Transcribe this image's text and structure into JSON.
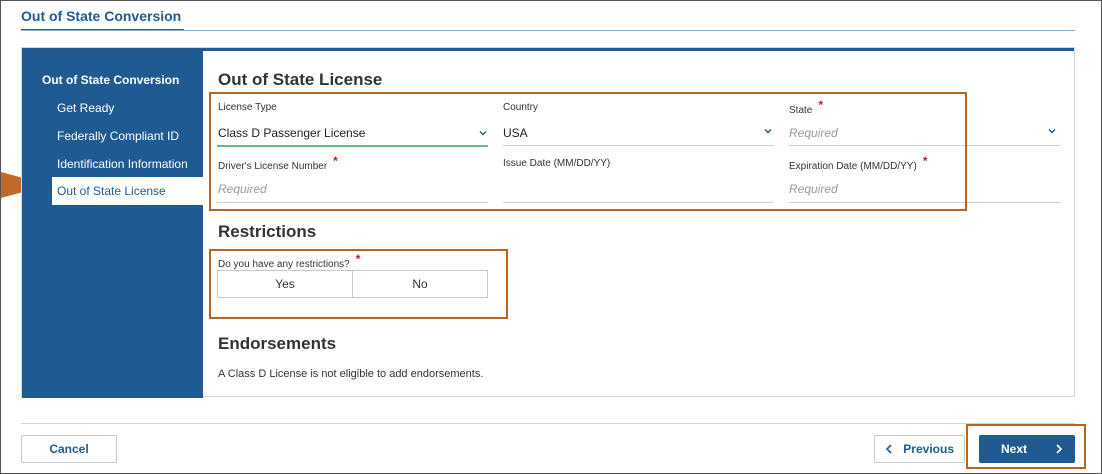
{
  "page": {
    "title": "Out of State Conversion"
  },
  "sidebar": {
    "heading": "Out of State Conversion",
    "items": [
      {
        "label": "Get Ready"
      },
      {
        "label": "Federally Compliant ID"
      },
      {
        "label": "Identification Information"
      },
      {
        "label": "Out of State License"
      }
    ],
    "active_index": 3
  },
  "license_section": {
    "title": "Out of State License",
    "license_type": {
      "label": "License Type",
      "value": "Class D Passenger License"
    },
    "country": {
      "label": "Country",
      "value": "USA"
    },
    "state": {
      "label": "State",
      "placeholder": "Required",
      "required": true
    },
    "dl_number": {
      "label": "Driver's License Number",
      "placeholder": "Required",
      "required": true
    },
    "issue_date": {
      "label": "Issue Date (MM/DD/YY)"
    },
    "expiration_date": {
      "label": "Expiration Date (MM/DD/YY)",
      "placeholder": "Required",
      "required": true
    }
  },
  "restrictions": {
    "title": "Restrictions",
    "question": "Do you have any restrictions?",
    "required": true,
    "options": [
      "Yes",
      "No"
    ]
  },
  "endorsements": {
    "title": "Endorsements",
    "message": "A Class D License is not eligible to add endorsements."
  },
  "footer": {
    "cancel_label": "Cancel",
    "previous_label": "Previous",
    "next_label": "Next"
  },
  "colors": {
    "brand_blue": "#1f5a93",
    "highlight_orange": "#b9651e",
    "required_red": "#c0202a",
    "focus_green": "#5fbf8a"
  },
  "icons": [
    "chevron-down-icon",
    "chevron-left-icon",
    "chevron-right-icon",
    "required-asterisk-icon"
  ]
}
